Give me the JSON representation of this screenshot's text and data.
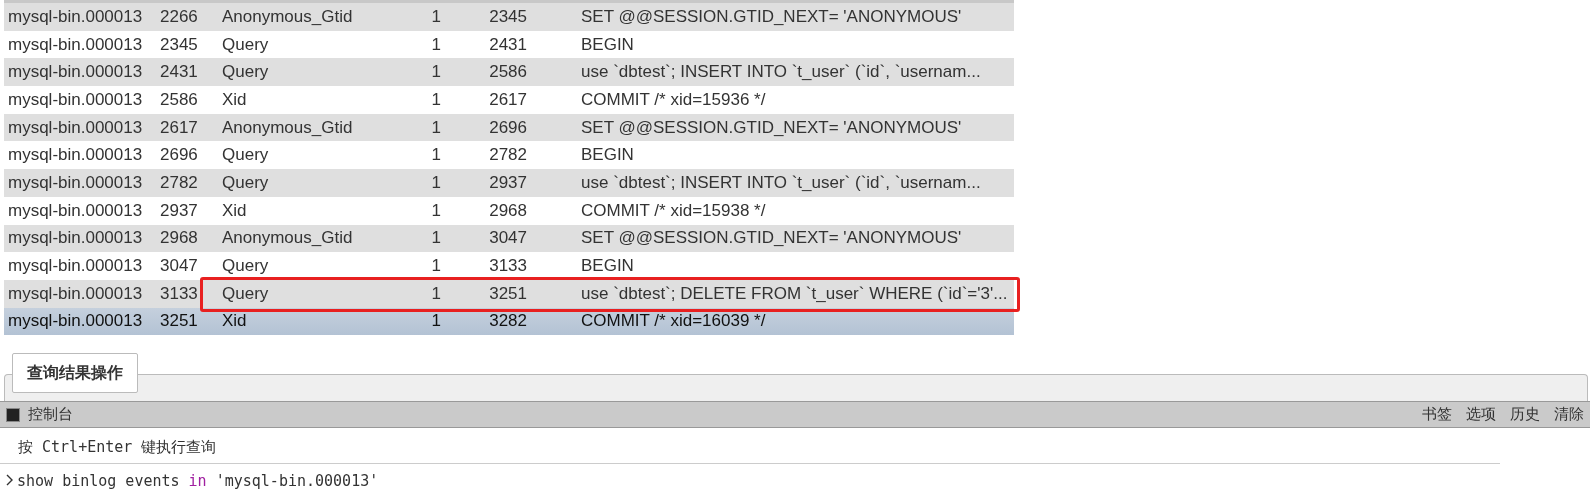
{
  "table": {
    "rows": [
      {
        "cells": [
          "mysql-bin.000013",
          "2266",
          "Anonymous_Gtid",
          "1",
          "2345",
          "SET @@SESSION.GTID_NEXT= 'ANONYMOUS'"
        ],
        "selected": false,
        "annotated": false
      },
      {
        "cells": [
          "mysql-bin.000013",
          "2345",
          "Query",
          "1",
          "2431",
          "BEGIN"
        ],
        "selected": false,
        "annotated": false
      },
      {
        "cells": [
          "mysql-bin.000013",
          "2431",
          "Query",
          "1",
          "2586",
          "use `dbtest`; INSERT INTO `t_user` (`id`, `usernam..."
        ],
        "selected": false,
        "annotated": false
      },
      {
        "cells": [
          "mysql-bin.000013",
          "2586",
          "Xid",
          "1",
          "2617",
          "COMMIT /* xid=15936 */"
        ],
        "selected": false,
        "annotated": false
      },
      {
        "cells": [
          "mysql-bin.000013",
          "2617",
          "Anonymous_Gtid",
          "1",
          "2696",
          "SET @@SESSION.GTID_NEXT= 'ANONYMOUS'"
        ],
        "selected": false,
        "annotated": false
      },
      {
        "cells": [
          "mysql-bin.000013",
          "2696",
          "Query",
          "1",
          "2782",
          "BEGIN"
        ],
        "selected": false,
        "annotated": false
      },
      {
        "cells": [
          "mysql-bin.000013",
          "2782",
          "Query",
          "1",
          "2937",
          "use `dbtest`; INSERT INTO `t_user` (`id`, `usernam..."
        ],
        "selected": false,
        "annotated": false
      },
      {
        "cells": [
          "mysql-bin.000013",
          "2937",
          "Xid",
          "1",
          "2968",
          "COMMIT /* xid=15938 */"
        ],
        "selected": false,
        "annotated": false
      },
      {
        "cells": [
          "mysql-bin.000013",
          "2968",
          "Anonymous_Gtid",
          "1",
          "3047",
          "SET @@SESSION.GTID_NEXT= 'ANONYMOUS'"
        ],
        "selected": false,
        "annotated": false
      },
      {
        "cells": [
          "mysql-bin.000013",
          "3047",
          "Query",
          "1",
          "3133",
          "BEGIN"
        ],
        "selected": false,
        "annotated": false
      },
      {
        "cells": [
          "mysql-bin.000013",
          "3133",
          "Query",
          "1",
          "3251",
          "use `dbtest`; DELETE FROM `t_user` WHERE (`id`='3'..."
        ],
        "selected": false,
        "annotated": true
      },
      {
        "cells": [
          "mysql-bin.000013",
          "3251",
          "Xid",
          "1",
          "3282",
          "COMMIT /* xid=16039 */"
        ],
        "selected": true,
        "annotated": false
      }
    ]
  },
  "result_tab": {
    "label": "查询结果操作"
  },
  "console": {
    "title": "控制台",
    "actions": [
      "书签",
      "选项",
      "历史",
      "清除"
    ],
    "hint": "按 Ctrl+Enter 键执行查询",
    "command": [
      {
        "text": "show binlog events ",
        "kind": "plain"
      },
      {
        "text": "in",
        "kind": "keyword"
      },
      {
        "text": " 'mysql-bin.000013'",
        "kind": "string"
      }
    ]
  }
}
